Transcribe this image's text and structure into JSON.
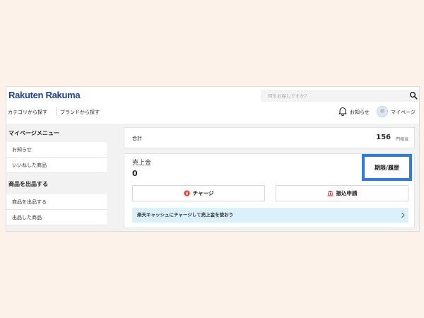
{
  "header": {
    "logo": "Rakuten Rakuma",
    "search_placeholder": "何をお探しですか？",
    "nav": [
      "カテゴリから探す",
      "ブランドから探す"
    ],
    "notifications_label": "お知らせ",
    "mypage_label": "マイページ"
  },
  "sidebar": {
    "menu_heading": "マイページメニュー",
    "menu_items": [
      "お知らせ",
      "いいねした商品"
    ],
    "sell_heading": "商品を出品する",
    "sell_items": [
      "商品を出品する",
      "出品した商品"
    ]
  },
  "main": {
    "total": {
      "label": "合計",
      "value": "156",
      "unit": "円相当"
    },
    "sales": {
      "title": "売上金",
      "value": "0",
      "history_button": "期限/履歴",
      "charge_button": "チャージ",
      "transfer_button": "振込申請",
      "promo": "楽天キャッシュにチャージして売上金を使おう"
    }
  },
  "colors": {
    "page_bg": "#fdf2ea",
    "brand": "#1d3f8f",
    "highlight": "#2d7de0",
    "charge_icon": "#e53935",
    "transfer_icon": "#d32f2f",
    "promo_bg": "#daf1fb"
  },
  "icons": [
    "search-icon",
    "bell-icon",
    "avatar",
    "yen-coin-icon",
    "bank-icon",
    "chevron-right-icon"
  ]
}
